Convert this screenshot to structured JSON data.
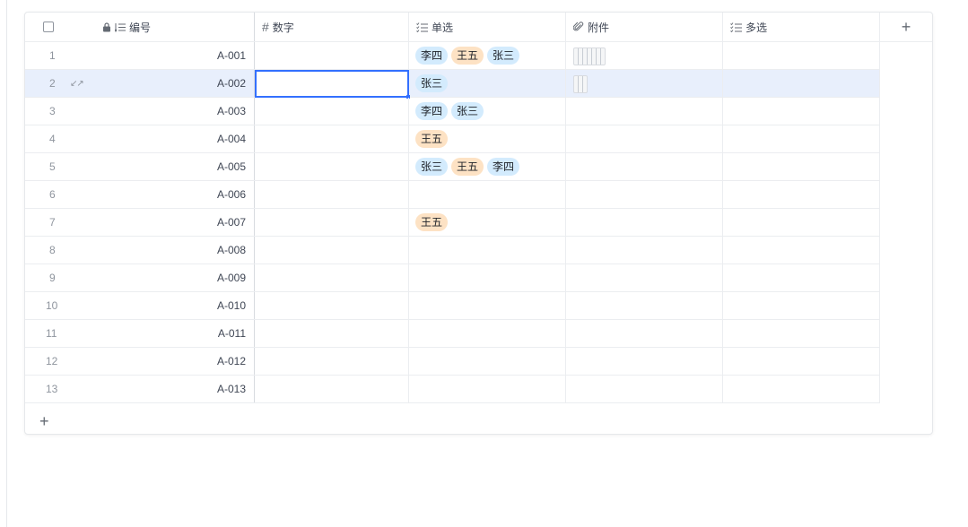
{
  "header": {
    "select_all_label": "",
    "col_id": "编号",
    "col_number": "数字",
    "col_single": "单选",
    "col_attach": "附件",
    "col_multi": "多选",
    "add_column_icon": "+"
  },
  "icons": {
    "lock": "lock-icon",
    "sort": "sort-icon",
    "hash": "#",
    "list": "list-icon",
    "paperclip": "paperclip-icon"
  },
  "rows": [
    {
      "num": "1",
      "code": "A-001",
      "number": "",
      "single": [
        {
          "text": "李四",
          "color": "blue"
        },
        {
          "text": "王五",
          "color": "orange"
        },
        {
          "text": "张三",
          "color": "blue"
        }
      ],
      "attach": "wide",
      "multi": ""
    },
    {
      "num": "2",
      "code": "A-002",
      "number": "",
      "single": [
        {
          "text": "张三",
          "color": "blue"
        }
      ],
      "attach": "small",
      "multi": ""
    },
    {
      "num": "3",
      "code": "A-003",
      "number": "",
      "single": [
        {
          "text": "李四",
          "color": "blue"
        },
        {
          "text": "张三",
          "color": "blue"
        }
      ],
      "attach": "",
      "multi": ""
    },
    {
      "num": "4",
      "code": "A-004",
      "number": "",
      "single": [
        {
          "text": "王五",
          "color": "orange"
        }
      ],
      "attach": "",
      "multi": ""
    },
    {
      "num": "5",
      "code": "A-005",
      "number": "",
      "single": [
        {
          "text": "张三",
          "color": "blue"
        },
        {
          "text": "王五",
          "color": "orange"
        },
        {
          "text": "李四",
          "color": "blue"
        }
      ],
      "attach": "",
      "multi": ""
    },
    {
      "num": "6",
      "code": "A-006",
      "number": "",
      "single": [],
      "attach": "",
      "multi": ""
    },
    {
      "num": "7",
      "code": "A-007",
      "number": "",
      "single": [
        {
          "text": "王五",
          "color": "orange"
        }
      ],
      "attach": "",
      "multi": ""
    },
    {
      "num": "8",
      "code": "A-008",
      "number": "",
      "single": [],
      "attach": "",
      "multi": ""
    },
    {
      "num": "9",
      "code": "A-009",
      "number": "",
      "single": [],
      "attach": "",
      "multi": ""
    },
    {
      "num": "10",
      "code": "A-010",
      "number": "",
      "single": [],
      "attach": "",
      "multi": ""
    },
    {
      "num": "11",
      "code": "A-011",
      "number": "",
      "single": [],
      "attach": "",
      "multi": ""
    },
    {
      "num": "12",
      "code": "A-012",
      "number": "",
      "single": [],
      "attach": "",
      "multi": ""
    },
    {
      "num": "13",
      "code": "A-013",
      "number": "",
      "single": [],
      "attach": "",
      "multi": ""
    }
  ],
  "selected_row": 1,
  "add_row_icon": "+",
  "colors": {
    "accent": "#3370ff",
    "selected_row_bg": "#e8effc",
    "tag_blue": "#d3ebfd",
    "tag_orange": "#fde2c4"
  }
}
